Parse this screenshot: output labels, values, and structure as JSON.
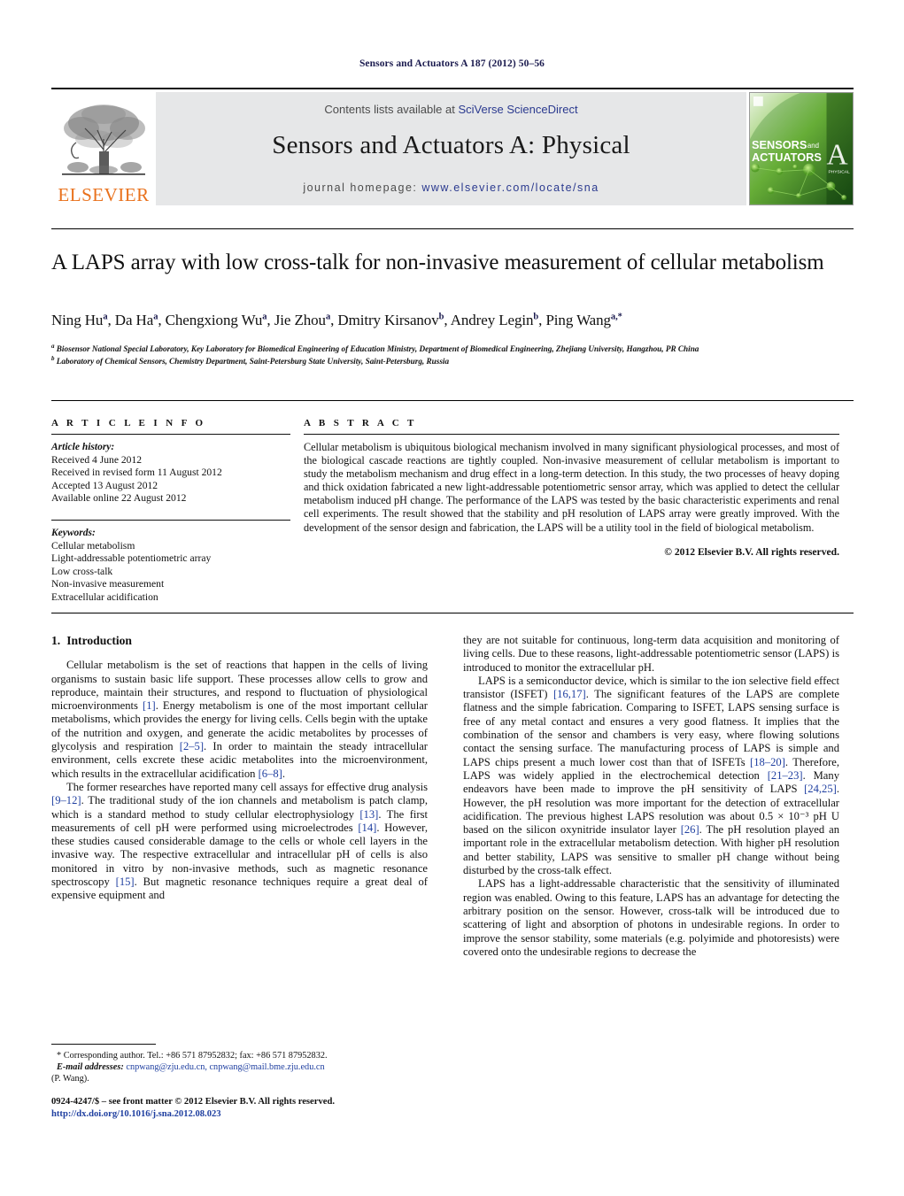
{
  "running_head": "Sensors and Actuators A 187 (2012) 50–56",
  "masthead": {
    "publisher_wordmark": "ELSEVIER",
    "contents_prefix": "Contents lists available at ",
    "contents_link": "SciVerse ScienceDirect",
    "journal_title": "Sensors and Actuators A: Physical",
    "homepage_label": "journal homepage:",
    "homepage_url": "www.elsevier.com/locate/sna",
    "cover": {
      "line1": "SENSORS",
      "line1_suffix": "and",
      "line2": "ACTUATORS",
      "letter": "A",
      "sub": "PHYSICAL"
    }
  },
  "article": {
    "title": "A LAPS array with low cross-talk for non-invasive measurement of cellular metabolism",
    "authors_html": "Ning Hu<sup>a</sup>, Da Ha<sup>a</sup>, Chengxiong Wu<sup>a</sup>, Jie Zhou<sup>a</sup>, Dmitry Kirsanov<sup>b</sup>, Andrey Legin<sup>b</sup>, Ping Wang<sup>a,</sup><sup>*</sup>",
    "affiliation_a": "Biosensor National Special Laboratory, Key Laboratory for Biomedical Engineering of Education Ministry, Department of Biomedical Engineering, Zhejiang University, Hangzhou, PR China",
    "affiliation_b": "Laboratory of Chemical Sensors, Chemistry Department, Saint-Petersburg State University, Saint-Petersburg, Russia"
  },
  "article_info": {
    "heading": "A R T I C L E  I N F O",
    "history_label": "Article history:",
    "history": [
      "Received 4 June 2012",
      "Received in revised form 11 August 2012",
      "Accepted 13 August 2012",
      "Available online 22 August 2012"
    ],
    "keywords_label": "Keywords:",
    "keywords": [
      "Cellular metabolism",
      "Light-addressable potentiometric array",
      "Low cross-talk",
      "Non-invasive measurement",
      "Extracellular acidification"
    ]
  },
  "abstract": {
    "heading": "A B S T R A C T",
    "text": "Cellular metabolism is ubiquitous biological mechanism involved in many significant physiological processes, and most of the biological cascade reactions are tightly coupled. Non-invasive measurement of cellular metabolism is important to study the metabolism mechanism and drug effect in a long-term detection. In this study, the two processes of heavy doping and thick oxidation fabricated a new light-addressable potentiometric sensor array, which was applied to detect the cellular metabolism induced pH change. The performance of the LAPS was tested by the basic characteristic experiments and renal cell experiments. The result showed that the stability and pH resolution of LAPS array were greatly improved. With the development of the sensor design and fabrication, the LAPS will be a utility tool in the field of biological metabolism.",
    "copyright": "© 2012 Elsevier B.V. All rights reserved."
  },
  "body": {
    "section_number": "1.",
    "section_title": "Introduction",
    "left_paragraphs": [
      "Cellular metabolism is the set of reactions that happen in the cells of living organisms to sustain basic life support. These processes allow cells to grow and reproduce, maintain their structures, and respond to fluctuation of physiological microenvironments [1]. Energy metabolism is one of the most important cellular metabolisms, which provides the energy for living cells. Cells begin with the uptake of the nutrition and oxygen, and generate the acidic metabolites by processes of glycolysis and respiration [2–5]. In order to maintain the steady intracellular environment, cells excrete these acidic metabolites into the microenvironment, which results in the extracellular acidification [6–8].",
      "The former researches have reported many cell assays for effective drug analysis [9–12]. The traditional study of the ion channels and metabolism is patch clamp, which is a standard method to study cellular electrophysiology [13]. The first measurements of cell pH were performed using microelectrodes [14]. However, these studies caused considerable damage to the cells or whole cell layers in the invasive way. The respective extracellular and intracellular pH of cells is also monitored in vitro by non-invasive methods, such as magnetic resonance spectroscopy [15]. But magnetic resonance techniques require a great deal of expensive equipment and"
    ],
    "right_paragraphs": [
      "they are not suitable for continuous, long-term data acquisition and monitoring of living cells. Due to these reasons, light-addressable potentiometric sensor (LAPS) is introduced to monitor the extracellular pH.",
      "LAPS is a semiconductor device, which is similar to the ion selective field effect transistor (ISFET) [16,17]. The significant features of the LAPS are complete flatness and the simple fabrication. Comparing to ISFET, LAPS sensing surface is free of any metal contact and ensures a very good flatness. It implies that the combination of the sensor and chambers is very easy, where flowing solutions contact the sensing surface. The manufacturing process of LAPS is simple and LAPS chips present a much lower cost than that of ISFETs [18–20]. Therefore, LAPS was widely applied in the electrochemical detection [21–23]. Many endeavors have been made to improve the pH sensitivity of LAPS [24,25]. However, the pH resolution was more important for the detection of extracellular acidification. The previous highest LAPS resolution was about 0.5 × 10⁻³ pH U based on the silicon oxynitride insulator layer [26]. The pH resolution played an important role in the extracellular metabolism detection. With higher pH resolution and better stability, LAPS was sensitive to smaller pH change without being disturbed by the cross-talk effect.",
      "LAPS has a light-addressable characteristic that the sensitivity of illuminated region was enabled. Owing to this feature, LAPS has an advantage for detecting the arbitrary position on the sensor. However, cross-talk will be introduced due to scattering of light and absorption of photons in undesirable regions. In order to improve the sensor stability, some materials (e.g. polyimide and photoresists) were covered onto the undesirable regions to decrease the"
    ]
  },
  "footnote": {
    "corresponding": "* Corresponding author. Tel.: +86 571 87952832; fax: +86 571 87952832.",
    "email_label": "E-mail addresses:",
    "emails": "cnpwang@zju.edu.cn, cnpwang@mail.bme.zju.edu.cn",
    "email_author": "(P. Wang)."
  },
  "page_footer": {
    "issn_line": "0924-4247/$ – see front matter © 2012 Elsevier B.V. All rights reserved.",
    "doi": "http://dx.doi.org/10.1016/j.sna.2012.08.023"
  },
  "colors": {
    "link": "#2b3a8f",
    "reference": "#1f3fa0",
    "elsevier_orange": "#E9711C",
    "banner_bg": "#e6e7e8",
    "running_head": "#1a1a4e"
  }
}
